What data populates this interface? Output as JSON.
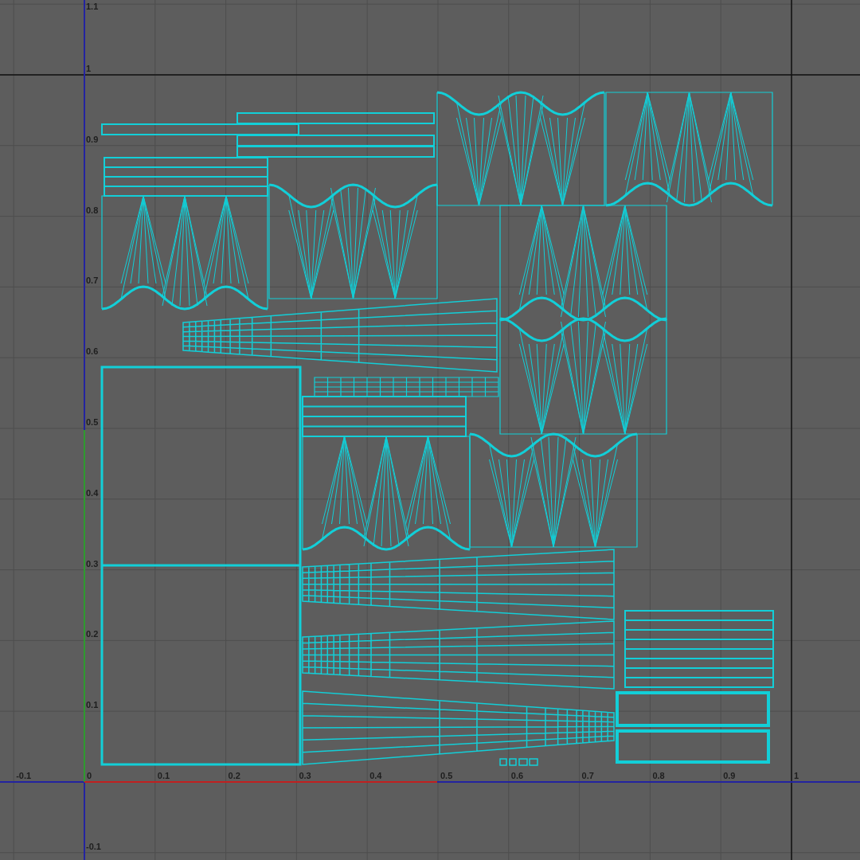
{
  "uv_editor": {
    "u_axis_labels": [
      "-0.1",
      "0",
      "0.1",
      "0.2",
      "0.3",
      "0.4",
      "0.5",
      "0.6",
      "0.7",
      "0.8",
      "0.9",
      "1"
    ],
    "v_axis_labels": [
      "1.1",
      "1",
      "0.9",
      "0.8",
      "0.7",
      "0.6",
      "0.5",
      "0.4",
      "0.3",
      "0.2",
      "0.1",
      "-0.1"
    ]
  }
}
